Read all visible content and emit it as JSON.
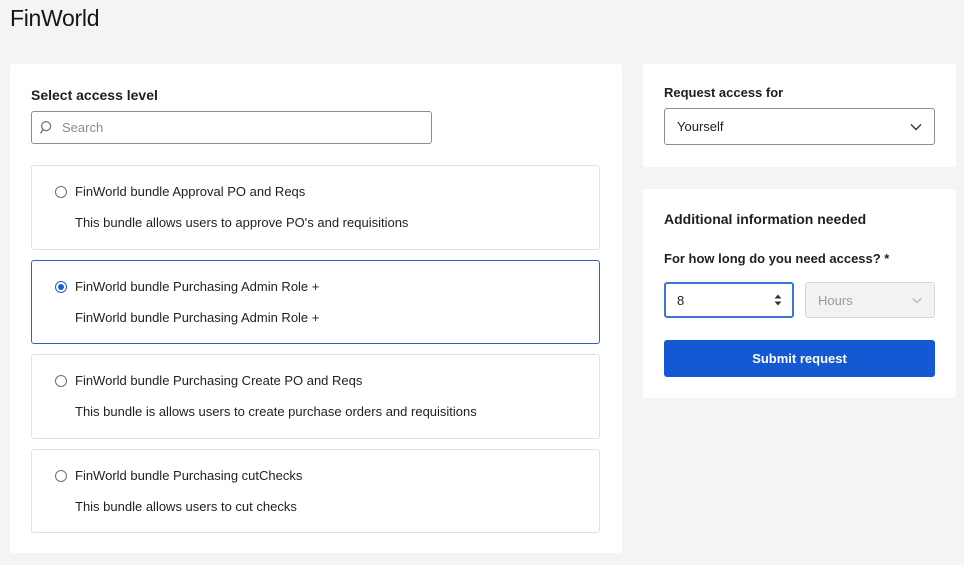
{
  "app": {
    "title": "FinWorld"
  },
  "access_level": {
    "label": "Select access level",
    "search_placeholder": "Search",
    "options": [
      {
        "title": "FinWorld bundle Approval PO and Reqs",
        "description": "This bundle allows users to approve PO's and requisitions",
        "selected": false
      },
      {
        "title": "FinWorld bundle Purchasing Admin Role +",
        "description": "FinWorld bundle Purchasing Admin Role +",
        "selected": true
      },
      {
        "title": "FinWorld bundle Purchasing Create PO and Reqs",
        "description": "This bundle is allows users to create purchase orders and requisitions",
        "selected": false
      },
      {
        "title": "FinWorld bundle Purchasing cutChecks",
        "description": "This bundle allows users to cut checks",
        "selected": false
      }
    ]
  },
  "request_for": {
    "label": "Request access for",
    "value": "Yourself"
  },
  "additional_info": {
    "title": "Additional information needed",
    "duration_label": "For how long do you need access? *",
    "duration_value": "8",
    "unit_value": "Hours",
    "submit_label": "Submit request"
  },
  "colors": {
    "accent": "#1458d4",
    "selected_border": "#2a63c4",
    "background": "#f4f4f4"
  }
}
